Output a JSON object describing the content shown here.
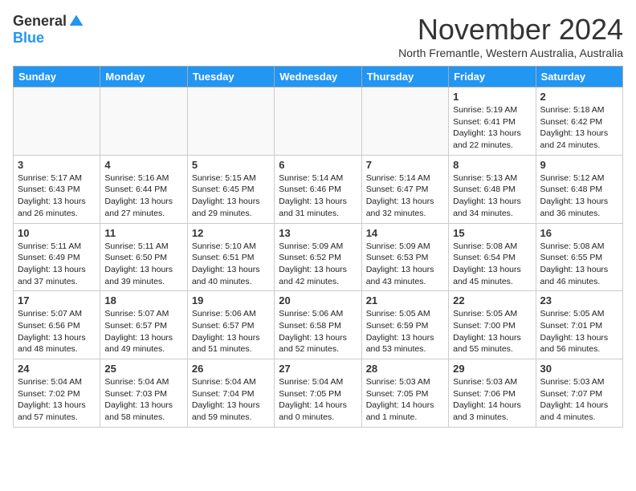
{
  "logo": {
    "general": "General",
    "blue": "Blue"
  },
  "header": {
    "month": "November 2024",
    "location": "North Fremantle, Western Australia, Australia"
  },
  "weekdays": [
    "Sunday",
    "Monday",
    "Tuesday",
    "Wednesday",
    "Thursday",
    "Friday",
    "Saturday"
  ],
  "weeks": [
    [
      {
        "day": "",
        "info": ""
      },
      {
        "day": "",
        "info": ""
      },
      {
        "day": "",
        "info": ""
      },
      {
        "day": "",
        "info": ""
      },
      {
        "day": "",
        "info": ""
      },
      {
        "day": "1",
        "info": "Sunrise: 5:19 AM\nSunset: 6:41 PM\nDaylight: 13 hours\nand 22 minutes."
      },
      {
        "day": "2",
        "info": "Sunrise: 5:18 AM\nSunset: 6:42 PM\nDaylight: 13 hours\nand 24 minutes."
      }
    ],
    [
      {
        "day": "3",
        "info": "Sunrise: 5:17 AM\nSunset: 6:43 PM\nDaylight: 13 hours\nand 26 minutes."
      },
      {
        "day": "4",
        "info": "Sunrise: 5:16 AM\nSunset: 6:44 PM\nDaylight: 13 hours\nand 27 minutes."
      },
      {
        "day": "5",
        "info": "Sunrise: 5:15 AM\nSunset: 6:45 PM\nDaylight: 13 hours\nand 29 minutes."
      },
      {
        "day": "6",
        "info": "Sunrise: 5:14 AM\nSunset: 6:46 PM\nDaylight: 13 hours\nand 31 minutes."
      },
      {
        "day": "7",
        "info": "Sunrise: 5:14 AM\nSunset: 6:47 PM\nDaylight: 13 hours\nand 32 minutes."
      },
      {
        "day": "8",
        "info": "Sunrise: 5:13 AM\nSunset: 6:48 PM\nDaylight: 13 hours\nand 34 minutes."
      },
      {
        "day": "9",
        "info": "Sunrise: 5:12 AM\nSunset: 6:48 PM\nDaylight: 13 hours\nand 36 minutes."
      }
    ],
    [
      {
        "day": "10",
        "info": "Sunrise: 5:11 AM\nSunset: 6:49 PM\nDaylight: 13 hours\nand 37 minutes."
      },
      {
        "day": "11",
        "info": "Sunrise: 5:11 AM\nSunset: 6:50 PM\nDaylight: 13 hours\nand 39 minutes."
      },
      {
        "day": "12",
        "info": "Sunrise: 5:10 AM\nSunset: 6:51 PM\nDaylight: 13 hours\nand 40 minutes."
      },
      {
        "day": "13",
        "info": "Sunrise: 5:09 AM\nSunset: 6:52 PM\nDaylight: 13 hours\nand 42 minutes."
      },
      {
        "day": "14",
        "info": "Sunrise: 5:09 AM\nSunset: 6:53 PM\nDaylight: 13 hours\nand 43 minutes."
      },
      {
        "day": "15",
        "info": "Sunrise: 5:08 AM\nSunset: 6:54 PM\nDaylight: 13 hours\nand 45 minutes."
      },
      {
        "day": "16",
        "info": "Sunrise: 5:08 AM\nSunset: 6:55 PM\nDaylight: 13 hours\nand 46 minutes."
      }
    ],
    [
      {
        "day": "17",
        "info": "Sunrise: 5:07 AM\nSunset: 6:56 PM\nDaylight: 13 hours\nand 48 minutes."
      },
      {
        "day": "18",
        "info": "Sunrise: 5:07 AM\nSunset: 6:57 PM\nDaylight: 13 hours\nand 49 minutes."
      },
      {
        "day": "19",
        "info": "Sunrise: 5:06 AM\nSunset: 6:57 PM\nDaylight: 13 hours\nand 51 minutes."
      },
      {
        "day": "20",
        "info": "Sunrise: 5:06 AM\nSunset: 6:58 PM\nDaylight: 13 hours\nand 52 minutes."
      },
      {
        "day": "21",
        "info": "Sunrise: 5:05 AM\nSunset: 6:59 PM\nDaylight: 13 hours\nand 53 minutes."
      },
      {
        "day": "22",
        "info": "Sunrise: 5:05 AM\nSunset: 7:00 PM\nDaylight: 13 hours\nand 55 minutes."
      },
      {
        "day": "23",
        "info": "Sunrise: 5:05 AM\nSunset: 7:01 PM\nDaylight: 13 hours\nand 56 minutes."
      }
    ],
    [
      {
        "day": "24",
        "info": "Sunrise: 5:04 AM\nSunset: 7:02 PM\nDaylight: 13 hours\nand 57 minutes."
      },
      {
        "day": "25",
        "info": "Sunrise: 5:04 AM\nSunset: 7:03 PM\nDaylight: 13 hours\nand 58 minutes."
      },
      {
        "day": "26",
        "info": "Sunrise: 5:04 AM\nSunset: 7:04 PM\nDaylight: 13 hours\nand 59 minutes."
      },
      {
        "day": "27",
        "info": "Sunrise: 5:04 AM\nSunset: 7:05 PM\nDaylight: 14 hours\nand 0 minutes."
      },
      {
        "day": "28",
        "info": "Sunrise: 5:03 AM\nSunset: 7:05 PM\nDaylight: 14 hours\nand 1 minute."
      },
      {
        "day": "29",
        "info": "Sunrise: 5:03 AM\nSunset: 7:06 PM\nDaylight: 14 hours\nand 3 minutes."
      },
      {
        "day": "30",
        "info": "Sunrise: 5:03 AM\nSunset: 7:07 PM\nDaylight: 14 hours\nand 4 minutes."
      }
    ]
  ]
}
